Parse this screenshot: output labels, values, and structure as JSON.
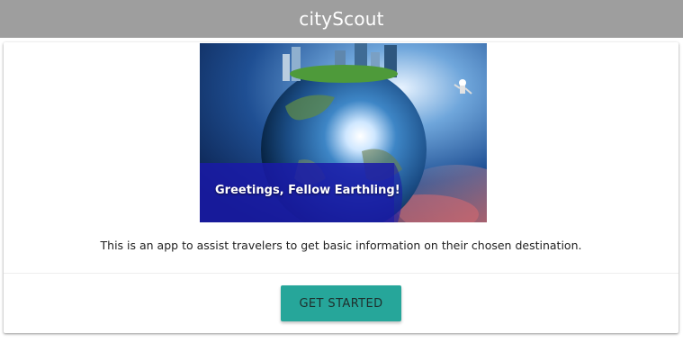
{
  "navbar": {
    "brand": "cityScout"
  },
  "card": {
    "image_caption": "Greetings, Fellow Earthling!",
    "description": "This is an app to assist travelers to get basic information on their chosen destination.",
    "action_label": "GET STARTED"
  },
  "colors": {
    "navbar_bg": "#9e9e9e",
    "button_bg": "#26a69a",
    "caption_overlay": "#1a1aa8"
  }
}
